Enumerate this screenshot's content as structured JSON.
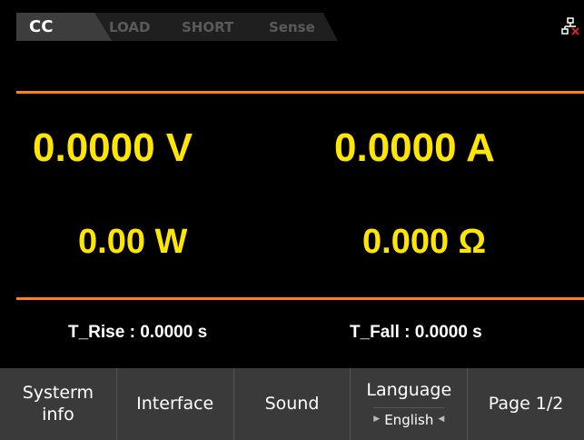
{
  "topbar": {
    "mode": "CC",
    "status_items": [
      "LOAD",
      "SHORT",
      "Sense"
    ],
    "network_icon": "network-disconnected-icon"
  },
  "readings": {
    "voltage": "0.0000 V",
    "current": "0.0000 A",
    "power": "0.00 W",
    "resistance": "0.000 Ω"
  },
  "timing": {
    "rise": "T_Rise : 0.0000 s",
    "fall": "T_Fall : 0.0000 s"
  },
  "softkeys": {
    "systerm_info_line1": "Systerm",
    "systerm_info_line2": "info",
    "interface": "Interface",
    "sound": "Sound",
    "language": "Language",
    "language_value": "English",
    "page": "Page 1/2"
  },
  "colors": {
    "reading": "#ffe600",
    "rule": "#ff7f1e",
    "softkey_bg": "#3a3a3a"
  }
}
